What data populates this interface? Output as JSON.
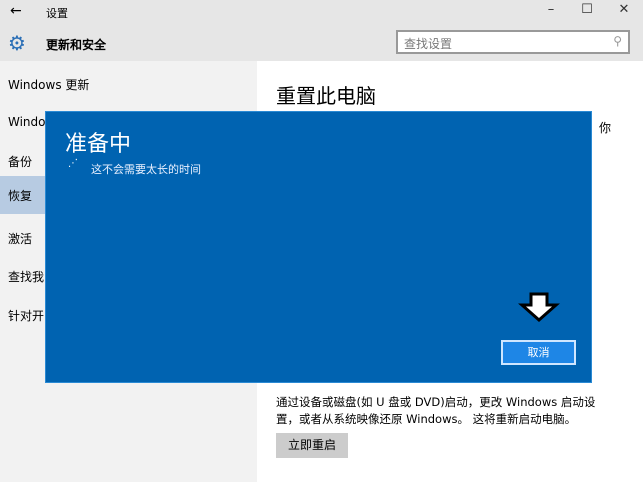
{
  "window": {
    "title": "设置",
    "back": "←",
    "min": "–",
    "max": "☐",
    "close": "✕"
  },
  "header": {
    "title": "更新和安全",
    "search_placeholder": "查找设置",
    "search_icon": "⚲",
    "gear_icon": "⚙"
  },
  "sidebar": {
    "items": [
      {
        "label": "Windows 更新"
      },
      {
        "label": "Windo"
      },
      {
        "label": "备份"
      },
      {
        "label": "恢复",
        "selected": true
      },
      {
        "label": "激活"
      },
      {
        "label": "查找我"
      },
      {
        "label": "针对开"
      }
    ]
  },
  "main": {
    "title": "重置此电脑",
    "partial": "你",
    "description": "通过设备或磁盘(如 U 盘或 DVD)启动，更改 Windows 启动设置，或者从系统映像还原 Windows。 这将重新启动电脑。",
    "restart_label": "立即重启"
  },
  "dialog": {
    "title": "准备中",
    "spinner": "⋰",
    "subtitle": "这不会需要太长的时间",
    "cancel_label": "取消"
  },
  "colors": {
    "dialog": "#0063b1",
    "selected": "#b7cbe2"
  }
}
